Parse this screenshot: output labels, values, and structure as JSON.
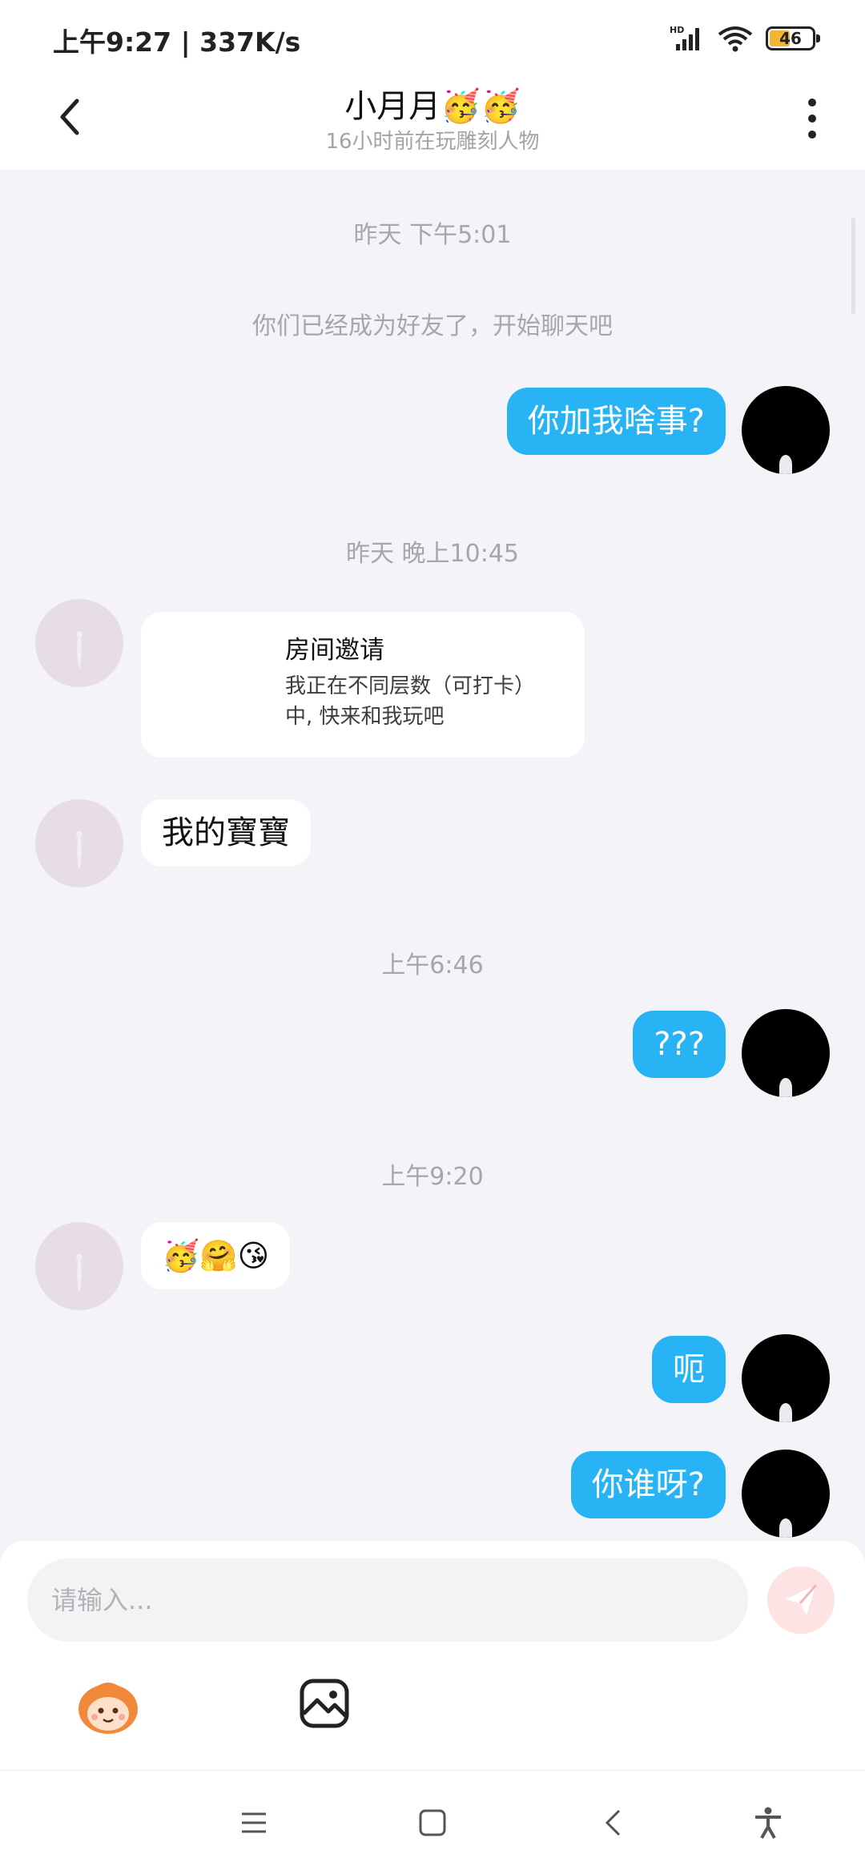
{
  "status_bar": {
    "time_speed": "上午9:27 | 337K/s",
    "network": "HD",
    "battery": "46"
  },
  "header": {
    "title": "小月月🥳🥳",
    "subtitle": "16小时前在玩雕刻人物"
  },
  "chat": {
    "t1": "昨天 下午5:01",
    "system_msg": "你们已经成为好友了，开始聊天吧",
    "m1": "你加我啥事?",
    "t2": "昨天 晚上10:45",
    "invite_title": "房间邀请",
    "invite_desc": "我正在不同层数（可打卡）中, 快来和我玩吧",
    "m2": "我的寶寶",
    "t3": "上午6:46",
    "m3": "???",
    "t4": "上午9:20",
    "m4": "🥳🤗😘",
    "m5": "呃",
    "m6": "你谁呀?"
  },
  "input": {
    "placeholder": "请输入..."
  },
  "colors": {
    "my_bubble": "#28b3f5",
    "other_bubble": "#ffffff",
    "chat_background": "#f4f3f7",
    "send_button": "#fde3e3"
  },
  "icons": {
    "back": "chevron-left-icon",
    "more": "more-vertical-icon",
    "send": "send-icon",
    "sticker": "mascot-sticker-icon",
    "image": "image-icon",
    "nav": [
      "menu-icon",
      "home-icon",
      "back-icon",
      "accessibility-icon"
    ]
  }
}
